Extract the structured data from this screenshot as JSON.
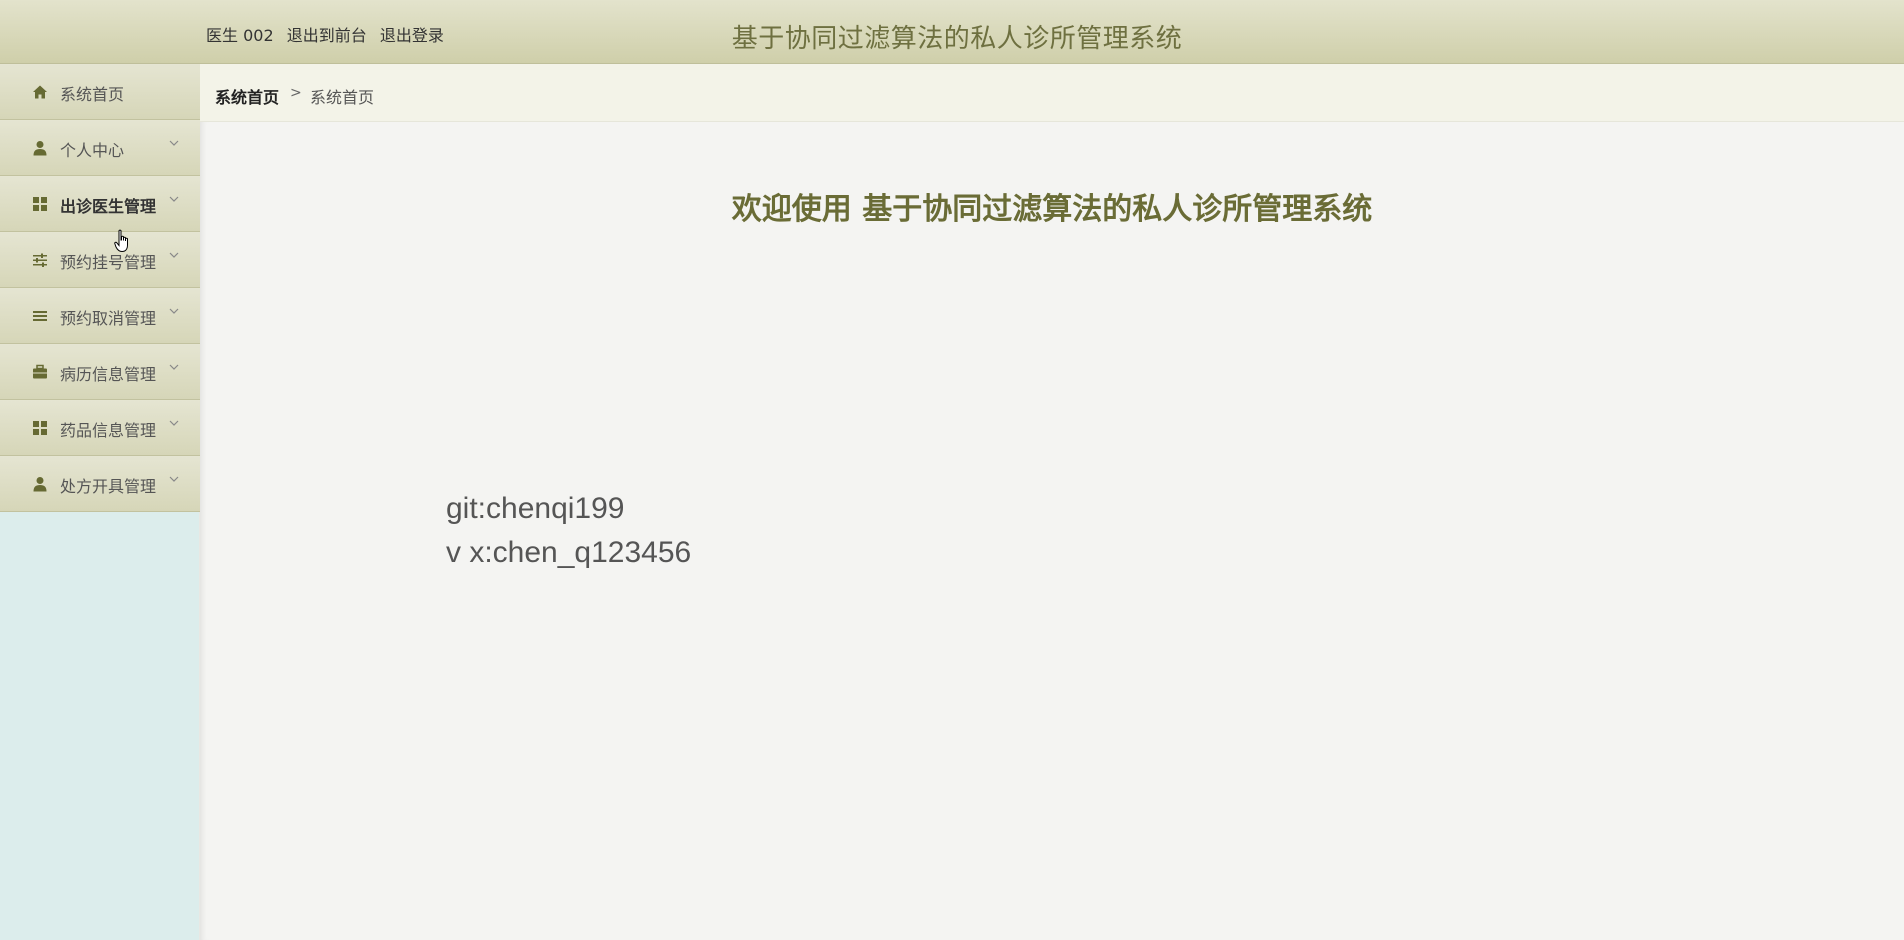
{
  "header": {
    "user_label": "医生 002",
    "link_front": "退出到前台",
    "link_logout": "退出登录",
    "system_title": "基于协同过滤算法的私人诊所管理系统"
  },
  "sidebar": {
    "items": [
      {
        "label": "系统首页",
        "icon": "home-icon",
        "has_arrow": false
      },
      {
        "label": "个人中心",
        "icon": "user-icon",
        "has_arrow": true
      },
      {
        "label": "出诊医生管理",
        "icon": "grid-icon",
        "has_arrow": true,
        "active": true
      },
      {
        "label": "预约挂号管理",
        "icon": "sliders-icon",
        "has_arrow": true
      },
      {
        "label": "预约取消管理",
        "icon": "list-icon",
        "has_arrow": true
      },
      {
        "label": "病历信息管理",
        "icon": "briefcase-icon",
        "has_arrow": true
      },
      {
        "label": "药品信息管理",
        "icon": "grid-icon",
        "has_arrow": true
      },
      {
        "label": "处方开具管理",
        "icon": "user-icon",
        "has_arrow": true
      }
    ]
  },
  "breadcrumb": {
    "home": "系统首页",
    "separator": ">",
    "current": "系统首页"
  },
  "main": {
    "welcome": "欢迎使用 基于协同过滤算法的私人诊所管理系统",
    "contact_git": "git:chenqi199",
    "contact_vx": "v x:chen_q123456"
  },
  "colors": {
    "accent_title": "#6a6c36",
    "header_bg": "#d8d8b8",
    "sidebar_bg": "#dcedec",
    "icon_color": "#666a33"
  }
}
